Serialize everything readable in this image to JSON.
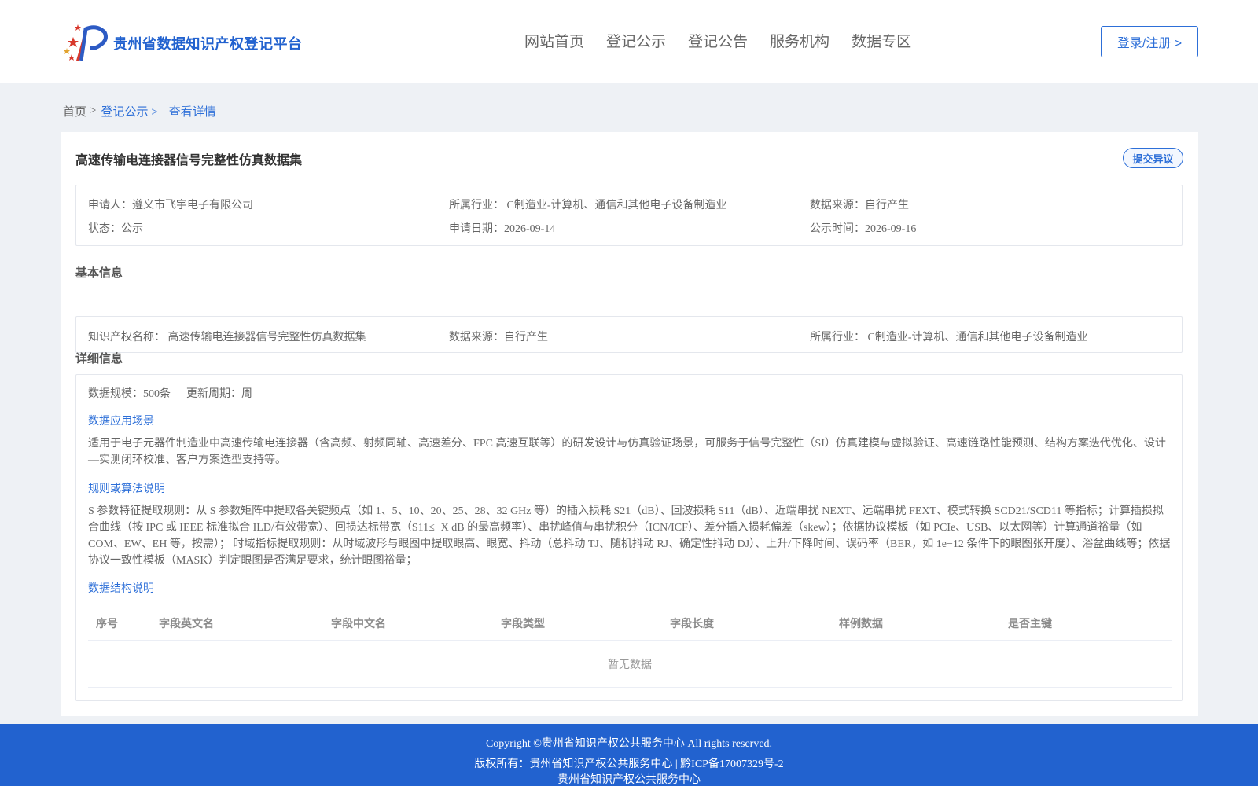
{
  "header": {
    "site_title": "贵州省数据知识产权登记平台",
    "nav": [
      "网站首页",
      "登记公示",
      "登记公告",
      "服务机构",
      "数据专区"
    ],
    "login_label": "登录/注册 >"
  },
  "breadcrumb": {
    "home": "首页",
    "sep": ">",
    "level1": "登记公示 >",
    "current": "查看详情"
  },
  "detail": {
    "title": "高速传输电连接器信号完整性仿真数据集",
    "objection_label": "提交异议",
    "summary": {
      "applicant": "申请人：遵义市飞宇电子有限公司",
      "industry": "所属行业： C制造业-计算机、通信和其他电子设备制造业",
      "source": "数据来源：自行产生",
      "status": "状态：公示",
      "apply_date": "申请日期：2026-09-14",
      "publish_date": "公示时间：2026-09-16"
    },
    "basic_title": "基本信息",
    "basic": {
      "ip_name": "知识产权名称： 高速传输电连接器信号完整性仿真数据集",
      "source": "数据来源：自行产生",
      "industry": "所属行业： C制造业-计算机、通信和其他电子设备制造业"
    },
    "detail_title": "详细信息",
    "scale": "数据规模：500条",
    "cycle": "更新周期：周",
    "scene_title": "数据应用场景",
    "scene_text": "适用于电子元器件制造业中高速传输电连接器（含高频、射频同轴、高速差分、FPC 高速互联等）的研发设计与仿真验证场景，可服务于信号完整性（SI）仿真建模与虚拟验证、高速链路性能预测、结构方案迭代优化、设计—实测闭环校准、客户方案选型支持等。",
    "rule_title": "规则或算法说明",
    "rule_text": "S 参数特征提取规则：从 S 参数矩阵中提取各关键频点（如 1、5、10、20、25、28、32 GHz 等）的插入损耗 S21（dB）、回波损耗 S11（dB）、近端串扰 NEXT、远端串扰 FEXT、模式转换 SCD21/SCD11 等指标；计算插损拟合曲线（按 IPC 或 IEEE 标准拟合 ILD/有效带宽）、回损达标带宽（S11≤−X dB 的最高频率）、串扰峰值与串扰积分（ICN/ICF）、差分插入损耗偏差（skew）；依据协议模板（如 PCIe、USB、以太网等）计算通道裕量（如 COM、EW、EH 等，按需）； 时域指标提取规则：从时域波形与眼图中提取眼高、眼宽、抖动（总抖动 TJ、随机抖动 RJ、确定性抖动 DJ）、上升/下降时间、误码率（BER，如 1e−12 条件下的眼图张开度）、浴盆曲线等；依据协议一致性模板（MASK）判定眼图是否满足要求，统计眼图裕量；",
    "struct_title": "数据结构说明",
    "table_headers": [
      "序号",
      "字段英文名",
      "字段中文名",
      "字段类型",
      "字段长度",
      "样例数据",
      "是否主键"
    ],
    "table_empty": "暂无数据"
  },
  "footer": {
    "copyright": "Copyright ©贵州省知识产权公共服务中心 All rights reserved.",
    "owner": "版权所有：贵州省知识产权公共服务中心 | 黔ICP备17007329号-2",
    "center": "贵州省知识产权公共服务中心"
  }
}
